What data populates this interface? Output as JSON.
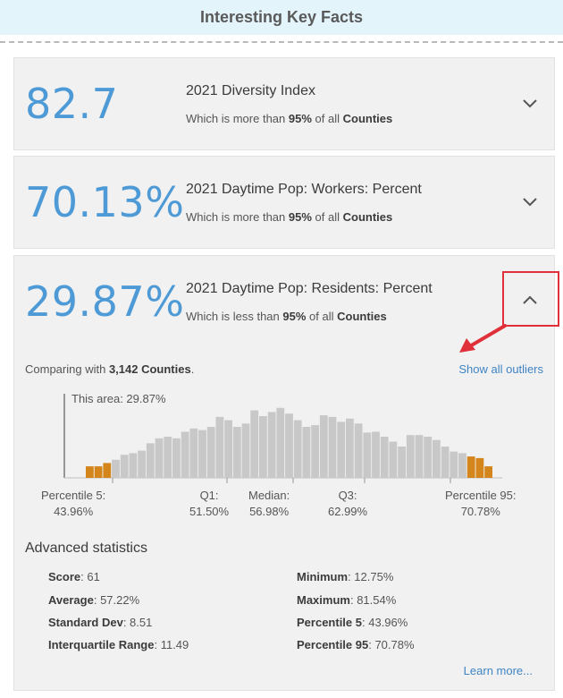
{
  "header": {
    "title": "Interesting Key Facts"
  },
  "facts": [
    {
      "value": "82.7",
      "title": "2021 Diversity Index",
      "sub_prefix": "Which is more than",
      "sub_pct": "95%",
      "sub_mid": "of all",
      "sub_unit": "Counties",
      "expanded": false
    },
    {
      "value": "70.13%",
      "title": "2021 Daytime Pop: Workers: Percent",
      "sub_prefix": "Which is more than",
      "sub_pct": "95%",
      "sub_mid": "of all",
      "sub_unit": "Counties",
      "expanded": false
    },
    {
      "value": "29.87%",
      "title": "2021 Daytime Pop: Residents: Percent",
      "sub_prefix": "Which is less than",
      "sub_pct": "95%",
      "sub_mid": "of all",
      "sub_unit": "Counties",
      "expanded": true
    }
  ],
  "detail": {
    "comparing_prefix": "Comparing with",
    "comparing_count": "3,142 Counties",
    "comparing_suffix": ".",
    "outliers_link": "Show all outliers",
    "this_area_label": "This area: 29.87%",
    "percentiles": [
      {
        "name": "Percentile 5:",
        "value": "43.96%"
      },
      {
        "name": "Q1:",
        "value": "51.50%"
      },
      {
        "name": "Median:",
        "value": "56.98%"
      },
      {
        "name": "Q3:",
        "value": "62.99%"
      },
      {
        "name": "Percentile 95:",
        "value": "70.78%"
      }
    ],
    "advanced_title": "Advanced statistics",
    "stats_left": [
      {
        "label": "Score",
        "value": "61"
      },
      {
        "label": "Average",
        "value": "57.22%"
      },
      {
        "label": "Standard Dev",
        "value": "8.51"
      },
      {
        "label": "Interquartile Range",
        "value": "11.49"
      }
    ],
    "stats_right": [
      {
        "label": "Minimum",
        "value": "12.75%"
      },
      {
        "label": "Maximum",
        "value": "81.54%"
      },
      {
        "label": "Percentile 5",
        "value": "43.96%"
      },
      {
        "label": "Percentile 95",
        "value": "70.78%"
      }
    ],
    "learn_more": "Learn more...",
    "colors": {
      "normal": "#c8c8c8",
      "outlier": "#d4861c",
      "accent": "#4d9ad6",
      "link": "#3f84c5"
    }
  },
  "chart_data": {
    "type": "bar",
    "title": "",
    "xlabel": "",
    "ylabel": "",
    "bins": [
      {
        "v": 0.14,
        "outlier": true
      },
      {
        "v": 0.14,
        "outlier": true
      },
      {
        "v": 0.18,
        "outlier": true
      },
      {
        "v": 0.22,
        "outlier": false
      },
      {
        "v": 0.28,
        "outlier": false
      },
      {
        "v": 0.3,
        "outlier": false
      },
      {
        "v": 0.33,
        "outlier": false
      },
      {
        "v": 0.42,
        "outlier": false
      },
      {
        "v": 0.48,
        "outlier": false
      },
      {
        "v": 0.5,
        "outlier": false
      },
      {
        "v": 0.48,
        "outlier": false
      },
      {
        "v": 0.56,
        "outlier": false
      },
      {
        "v": 0.6,
        "outlier": false
      },
      {
        "v": 0.58,
        "outlier": false
      },
      {
        "v": 0.62,
        "outlier": false
      },
      {
        "v": 0.74,
        "outlier": false
      },
      {
        "v": 0.7,
        "outlier": false
      },
      {
        "v": 0.62,
        "outlier": false
      },
      {
        "v": 0.66,
        "outlier": false
      },
      {
        "v": 0.82,
        "outlier": false
      },
      {
        "v": 0.75,
        "outlier": false
      },
      {
        "v": 0.8,
        "outlier": false
      },
      {
        "v": 0.85,
        "outlier": false
      },
      {
        "v": 0.78,
        "outlier": false
      },
      {
        "v": 0.7,
        "outlier": false
      },
      {
        "v": 0.62,
        "outlier": false
      },
      {
        "v": 0.64,
        "outlier": false
      },
      {
        "v": 0.76,
        "outlier": false
      },
      {
        "v": 0.74,
        "outlier": false
      },
      {
        "v": 0.68,
        "outlier": false
      },
      {
        "v": 0.72,
        "outlier": false
      },
      {
        "v": 0.66,
        "outlier": false
      },
      {
        "v": 0.55,
        "outlier": false
      },
      {
        "v": 0.56,
        "outlier": false
      },
      {
        "v": 0.5,
        "outlier": false
      },
      {
        "v": 0.44,
        "outlier": false
      },
      {
        "v": 0.38,
        "outlier": false
      },
      {
        "v": 0.52,
        "outlier": false
      },
      {
        "v": 0.52,
        "outlier": false
      },
      {
        "v": 0.5,
        "outlier": false
      },
      {
        "v": 0.46,
        "outlier": false
      },
      {
        "v": 0.38,
        "outlier": false
      },
      {
        "v": 0.32,
        "outlier": false
      },
      {
        "v": 0.3,
        "outlier": false
      },
      {
        "v": 0.26,
        "outlier": true
      },
      {
        "v": 0.24,
        "outlier": true
      },
      {
        "v": 0.14,
        "outlier": true
      }
    ]
  }
}
